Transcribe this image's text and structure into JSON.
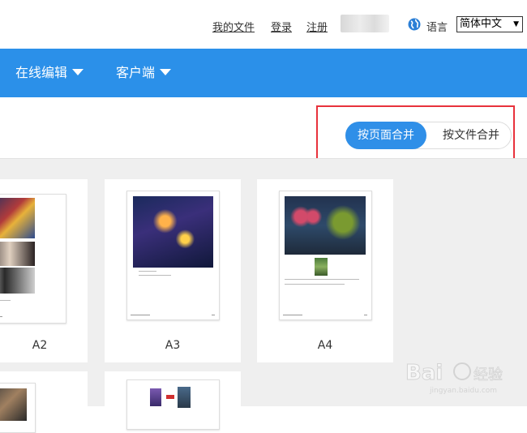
{
  "topbar": {
    "my_files": "我的文件",
    "login": "登录",
    "register": "注册",
    "language_label": "语言",
    "language_selected": "简体中文"
  },
  "nav": {
    "items": [
      {
        "label": "在线编辑"
      },
      {
        "label": "客户端"
      }
    ]
  },
  "merge_mode": {
    "options": [
      "按页面合并",
      "按文件合并"
    ],
    "selected": "按页面合并"
  },
  "pages": [
    {
      "label": "A2"
    },
    {
      "label": "A3"
    },
    {
      "label": "A4"
    }
  ],
  "colors": {
    "nav_bg": "#2b90e9",
    "toggle_active": "#2f8fe8",
    "highlight": "#e8323c",
    "workspace_bg": "#efefef"
  }
}
